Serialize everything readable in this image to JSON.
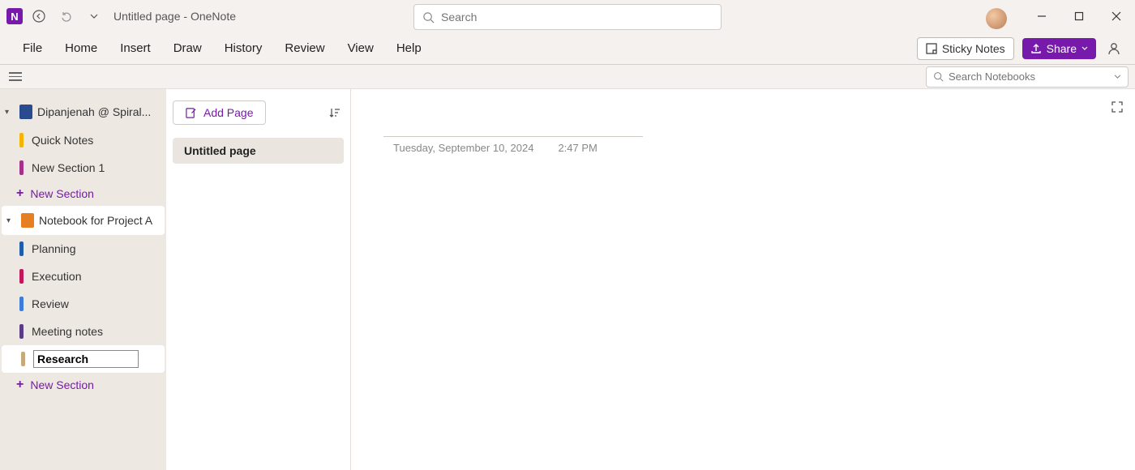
{
  "titlebar": {
    "page_title": "Untitled page",
    "app_name": "OneNote",
    "separator": "  -  ",
    "search_placeholder": "Search"
  },
  "menubar": {
    "items": [
      "File",
      "Home",
      "Insert",
      "Draw",
      "History",
      "Review",
      "View",
      "Help"
    ],
    "sticky_notes": "Sticky Notes",
    "share": "Share"
  },
  "toolrow": {
    "nb_search_placeholder": "Search Notebooks"
  },
  "sidebar": {
    "notebooks": [
      {
        "name": "Dipanjenah @ Spiral...",
        "color": "#2a4b8d",
        "sections": [
          {
            "name": "Quick Notes",
            "color": "#f5b400"
          },
          {
            "name": "New Section 1",
            "color": "#a4328a"
          }
        ]
      },
      {
        "name": "Notebook for Project A",
        "color": "#e67e22",
        "selected": true,
        "sections": [
          {
            "name": "Planning",
            "color": "#1f5faa"
          },
          {
            "name": "Execution",
            "color": "#c2185b"
          },
          {
            "name": "Review",
            "color": "#3b7dd8"
          },
          {
            "name": "Meeting notes",
            "color": "#5b3c88"
          },
          {
            "name": "Research",
            "color": "#c9a87c",
            "editing": true
          }
        ]
      }
    ],
    "new_section": "New Section"
  },
  "pagelist": {
    "add_page": "Add Page",
    "pages": [
      {
        "title": "Untitled page",
        "selected": true
      }
    ]
  },
  "canvas": {
    "date": "Tuesday, September 10, 2024",
    "time": "2:47 PM"
  }
}
